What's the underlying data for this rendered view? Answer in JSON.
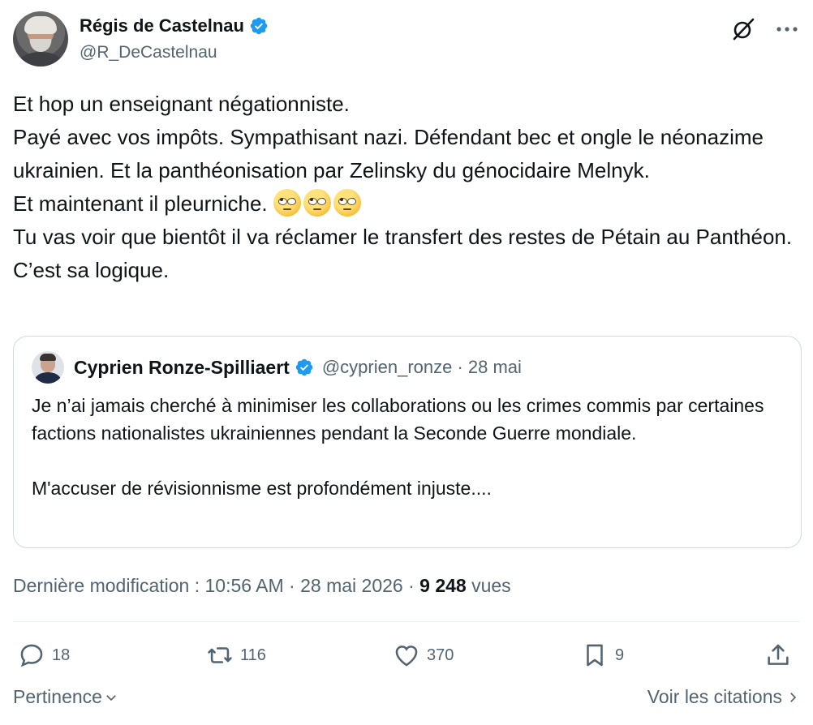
{
  "author": {
    "name": "Régis de Castelnau",
    "handle": "@R_DeCastelnau"
  },
  "post": {
    "line1": "Et hop un enseignant négationniste.",
    "line2": "Payé avec vos impôts. Sympathisant nazi. Défendant bec et ongle le néonazime ukrainien. Et la panthéonisation par Zelinsky du génocidaire Melnyk.",
    "line3": "Et maintenant il pleurniche. ",
    "line4": "Tu vas voir que bientôt il va réclamer le transfert des restes de Pétain au Panthéon. C’est sa logique.",
    "emoji_count": 3,
    "emoji_name": "face-with-rolling-eyes"
  },
  "quote": {
    "name": "Cyprien Ronze-Spilliaert",
    "meta": "@cyprien_ronze · 28 mai",
    "text_p1": "Je n’ai jamais cherché à minimiser les collaborations ou les crimes commis par certaines factions nationalistes ukrainiennes pendant la Seconde Guerre mondiale.",
    "text_p2": "M'accuser de révisionnisme est profondément injuste...."
  },
  "meta": {
    "modified": "Dernière modification : 10:56 AM · 28 mai 2026 · ",
    "views_count": "9 248",
    "views_label": " vues"
  },
  "actions": {
    "replies": "18",
    "reposts": "116",
    "likes": "370",
    "bookmarks": "9"
  },
  "footer": {
    "sort_label": "Pertinence",
    "quotes_link": "Voir les citations"
  },
  "colors": {
    "verified": "#1d9bf0",
    "text_primary": "#0f1419",
    "text_secondary": "#536471",
    "border": "#cfd9de"
  }
}
